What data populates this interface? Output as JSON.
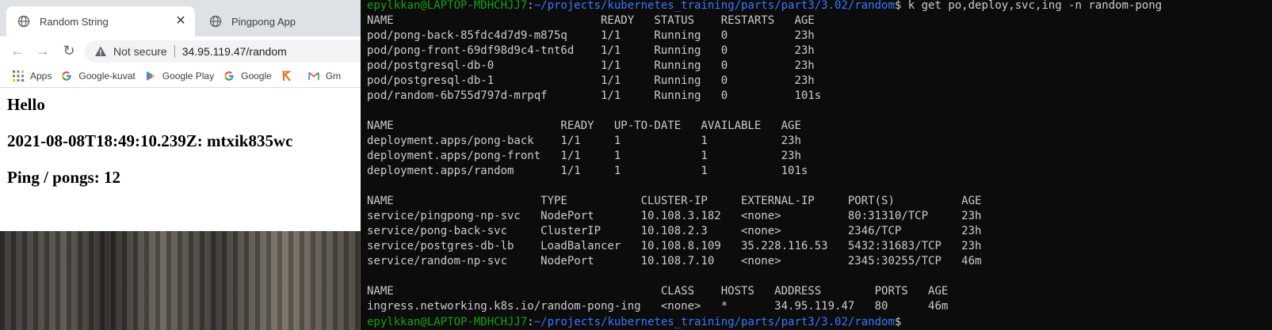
{
  "browser": {
    "tabs": [
      {
        "label": "Random String",
        "active": true
      },
      {
        "label": "Pingpong App",
        "active": false
      }
    ],
    "close_glyph": "✕",
    "nav": {
      "back": "←",
      "forward": "→",
      "reload": "↻"
    },
    "security_label": "Not secure",
    "url": "34.95.119.47/random",
    "bookmarks": [
      {
        "label": "Apps",
        "icon": "apps-grid-icon"
      },
      {
        "label": "Google-kuvat",
        "icon": "google-icon"
      },
      {
        "label": "Google Play",
        "icon": "google-play-icon"
      },
      {
        "label": "Google",
        "icon": "google-icon"
      },
      {
        "label": "",
        "icon": "k-icon"
      },
      {
        "label": "Gm",
        "icon": "gmail-icon"
      }
    ],
    "page": {
      "hello": "Hello",
      "stamp": "2021-08-08T18:49:10.239Z: mtxik835wc",
      "pings": "Ping / pongs: 12"
    }
  },
  "terminal": {
    "prompt_user": "epylkkan@LAPTOP-MDHCHJJ7",
    "prompt_colon": ":",
    "prompt_path": "~/projects/kubernetes_training/parts/part3/3.02/random",
    "prompt_sign": "$",
    "command": " k get po,deploy,svc,ing -n random-pong",
    "lines": [
      "NAME                               READY   STATUS    RESTARTS   AGE",
      "pod/pong-back-85fdc4d7d9-m875q     1/1     Running   0          23h",
      "pod/pong-front-69df98d9c4-tnt6d    1/1     Running   0          23h",
      "pod/postgresql-db-0                1/1     Running   0          23h",
      "pod/postgresql-db-1                1/1     Running   0          23h",
      "pod/random-6b755d797d-mrpqf        1/1     Running   0          101s",
      "",
      "NAME                         READY   UP-TO-DATE   AVAILABLE   AGE",
      "deployment.apps/pong-back    1/1     1            1           23h",
      "deployment.apps/pong-front   1/1     1            1           23h",
      "deployment.apps/random       1/1     1            1           101s",
      "",
      "NAME                      TYPE           CLUSTER-IP     EXTERNAL-IP     PORT(S)          AGE",
      "service/pingpong-np-svc   NodePort       10.108.3.182   <none>          80:31310/TCP     23h",
      "service/pong-back-svc     ClusterIP      10.108.2.3     <none>          2346/TCP         23h",
      "service/postgres-db-lb    LoadBalancer   10.108.8.109   35.228.116.53   5432:31683/TCP   23h",
      "service/random-np-svc     NodePort       10.108.7.10    <none>          2345:30255/TCP   46m",
      "",
      "NAME                                        CLASS    HOSTS   ADDRESS        PORTS   AGE",
      "ingress.networking.k8s.io/random-pong-ing   <none>   *       34.95.119.47   80      46m"
    ]
  },
  "colors": {
    "prompt_user": "#13a10e",
    "prompt_path": "#3b78ff",
    "terminal_text": "#cccccc",
    "terminal_bg": "#0c0c0c"
  }
}
